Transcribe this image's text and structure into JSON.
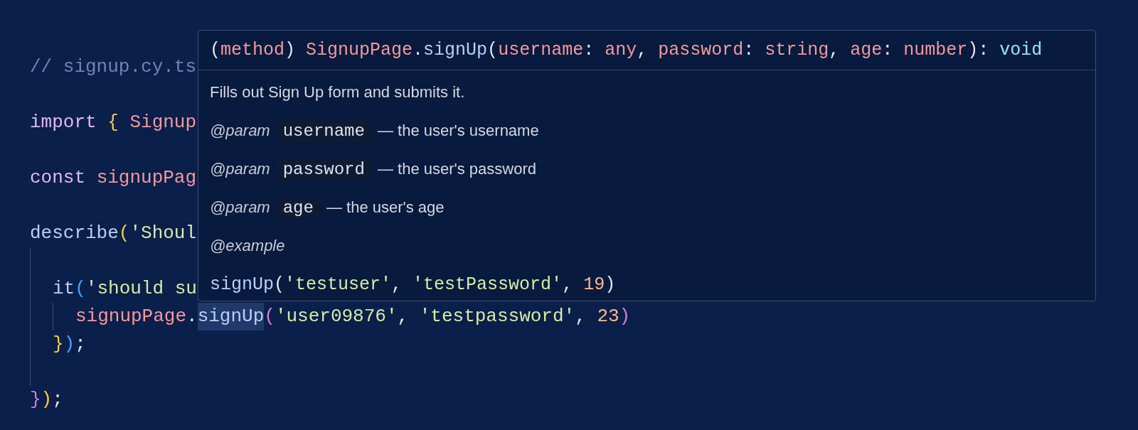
{
  "editor": {
    "lines": [
      {
        "kind": "code",
        "tokens": [
          {
            "text": "// signup.cy.ts",
            "kind": "comment"
          }
        ]
      },
      {
        "kind": "blank"
      },
      {
        "kind": "code",
        "tokens": [
          {
            "text": "import ",
            "kind": "keyword"
          },
          {
            "text": "{ ",
            "kind": "bracket1"
          },
          {
            "text": "Signup",
            "kind": "ident"
          }
        ]
      },
      {
        "kind": "blank"
      },
      {
        "kind": "code",
        "tokens": [
          {
            "text": "const ",
            "kind": "keyword"
          },
          {
            "text": "signupPag",
            "kind": "ident"
          }
        ]
      },
      {
        "kind": "blank"
      },
      {
        "kind": "code",
        "tokens": [
          {
            "text": "describe",
            "kind": "func"
          },
          {
            "text": "(",
            "kind": "bracket1"
          },
          {
            "text": "'Shoul",
            "kind": "string"
          }
        ],
        "children": [
          {
            "kind": "blank"
          },
          {
            "kind": "code",
            "tokens": [
              {
                "text": "it",
                "kind": "func"
              },
              {
                "text": "(",
                "kind": "bracket3"
              },
              {
                "text": "'should su",
                "kind": "string"
              }
            ],
            "children": [
              {
                "kind": "code",
                "tokens": [
                  {
                    "text": "signupPage",
                    "kind": "ident"
                  },
                  {
                    "text": ".",
                    "kind": "punct"
                  },
                  {
                    "text": "signUp",
                    "kind": "func",
                    "hovered": true
                  },
                  {
                    "text": "(",
                    "kind": "bracket2"
                  },
                  {
                    "text": "'user09876'",
                    "kind": "string"
                  },
                  {
                    "text": ", ",
                    "kind": "punct"
                  },
                  {
                    "text": "'testpassword'",
                    "kind": "string"
                  },
                  {
                    "text": ", ",
                    "kind": "punct"
                  },
                  {
                    "text": "23",
                    "kind": "number"
                  },
                  {
                    "text": ")",
                    "kind": "bracket2"
                  }
                ]
              }
            ]
          },
          {
            "kind": "code",
            "tokens": [
              {
                "text": "}",
                "kind": "bracket1"
              },
              {
                "text": ")",
                "kind": "bracket3"
              },
              {
                "text": ";",
                "kind": "punct"
              }
            ]
          },
          {
            "kind": "blank"
          }
        ]
      },
      {
        "kind": "code",
        "tokens": [
          {
            "text": "}",
            "kind": "bracket2"
          },
          {
            "text": ")",
            "kind": "bracket1"
          },
          {
            "text": ";",
            "kind": "punct"
          }
        ]
      }
    ]
  },
  "hover": {
    "signature": [
      {
        "text": "(",
        "kind": "punct"
      },
      {
        "text": "method",
        "kind": "ident"
      },
      {
        "text": ") ",
        "kind": "punct"
      },
      {
        "text": "SignupPage",
        "kind": "ident"
      },
      {
        "text": ".",
        "kind": "punct"
      },
      {
        "text": "signUp",
        "kind": "func"
      },
      {
        "text": "(",
        "kind": "punct"
      },
      {
        "text": "username",
        "kind": "ident"
      },
      {
        "text": ": ",
        "kind": "punct"
      },
      {
        "text": "any",
        "kind": "ident"
      },
      {
        "text": ", ",
        "kind": "punct"
      },
      {
        "text": "password",
        "kind": "ident"
      },
      {
        "text": ": ",
        "kind": "punct"
      },
      {
        "text": "string",
        "kind": "ident"
      },
      {
        "text": ", ",
        "kind": "punct"
      },
      {
        "text": "age",
        "kind": "ident"
      },
      {
        "text": ": ",
        "kind": "punct"
      },
      {
        "text": "number",
        "kind": "ident"
      },
      {
        "text": "): ",
        "kind": "punct"
      },
      {
        "text": "void",
        "kind": "type"
      }
    ],
    "description": "Fills out Sign Up form and submits it.",
    "params": [
      {
        "tag": "@param",
        "name": "username",
        "text": "— the user's username"
      },
      {
        "tag": "@param",
        "name": "password",
        "text": "— the user's password"
      },
      {
        "tag": "@param",
        "name": "age",
        "text": "— the user's age"
      }
    ],
    "example_tag": "@example",
    "example": [
      {
        "text": "signUp",
        "kind": "func"
      },
      {
        "text": "(",
        "kind": "punct"
      },
      {
        "text": "'testuser'",
        "kind": "string"
      },
      {
        "text": ", ",
        "kind": "punct"
      },
      {
        "text": "'testPassword'",
        "kind": "string"
      },
      {
        "text": ", ",
        "kind": "punct"
      },
      {
        "text": "19",
        "kind": "number"
      },
      {
        "text": ")",
        "kind": "punct"
      }
    ]
  }
}
